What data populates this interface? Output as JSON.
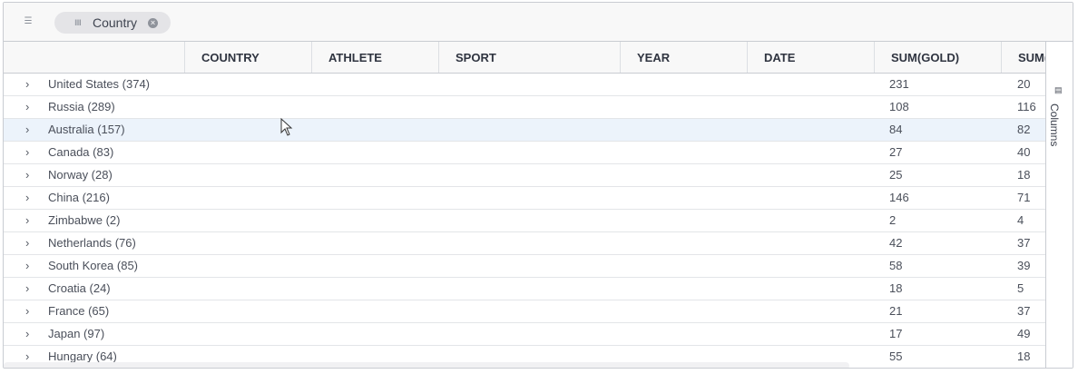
{
  "groupbar": {
    "group_icon": "group-panel-icon",
    "chip_label": "Country"
  },
  "headers": [
    "",
    "COUNTRY",
    "ATHLETE",
    "SPORT",
    "YEAR",
    "DATE",
    "SUM(GOLD)",
    "SUM("
  ],
  "rows": [
    {
      "name": "United States (374)",
      "gold": "231",
      "silver": "20"
    },
    {
      "name": "Russia (289)",
      "gold": "108",
      "silver": "116"
    },
    {
      "name": "Australia (157)",
      "gold": "84",
      "silver": "82"
    },
    {
      "name": "Canada (83)",
      "gold": "27",
      "silver": "40"
    },
    {
      "name": "Norway (28)",
      "gold": "25",
      "silver": "18"
    },
    {
      "name": "China (216)",
      "gold": "146",
      "silver": "71"
    },
    {
      "name": "Zimbabwe (2)",
      "gold": "2",
      "silver": "4"
    },
    {
      "name": "Netherlands (76)",
      "gold": "42",
      "silver": "37"
    },
    {
      "name": "South Korea (85)",
      "gold": "58",
      "silver": "39"
    },
    {
      "name": "Croatia (24)",
      "gold": "18",
      "silver": "5"
    },
    {
      "name": "France (65)",
      "gold": "21",
      "silver": "37"
    },
    {
      "name": "Japan (97)",
      "gold": "17",
      "silver": "49"
    },
    {
      "name": "Hungary (64)",
      "gold": "55",
      "silver": "18"
    }
  ],
  "sidebar": {
    "columns_label": "Columns"
  },
  "chevron": "›"
}
